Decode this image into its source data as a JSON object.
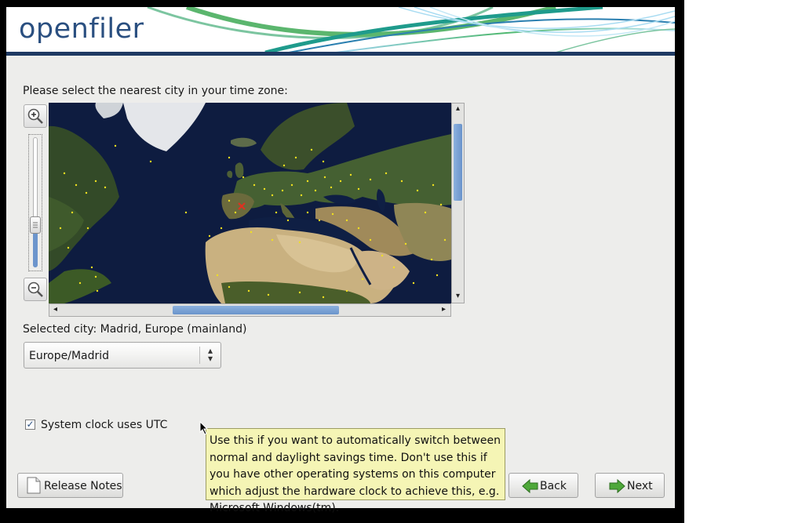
{
  "app": {
    "logo_text": "openfiler"
  },
  "timezone": {
    "prompt": "Please select the nearest city in your time zone:",
    "selected_city": "Selected city: Madrid, Europe (mainland)",
    "select_value": "Europe/Madrid"
  },
  "utc": {
    "label": "System clock uses UTC",
    "checked": true
  },
  "tooltip": {
    "text": "Use this if you want to automatically switch between normal and daylight savings time. Don't use this if you have other operating systems on this computer which adjust the hardware clock to achieve this, e.g. Microsoft Windows(tm)."
  },
  "buttons": {
    "release_notes": "Release Notes",
    "back": "Back",
    "next": "Next"
  },
  "icons": {
    "zoom_in": "zoom-in-icon",
    "zoom_out": "zoom-out-icon",
    "back": "back-arrow-icon",
    "next": "next-arrow-icon",
    "release_notes": "document-icon"
  },
  "colors": {
    "brand": "#2a4f80",
    "tooltip_bg": "#f5f5b5",
    "selected_marker": "#e03020",
    "city_dots": "#f0e020"
  }
}
